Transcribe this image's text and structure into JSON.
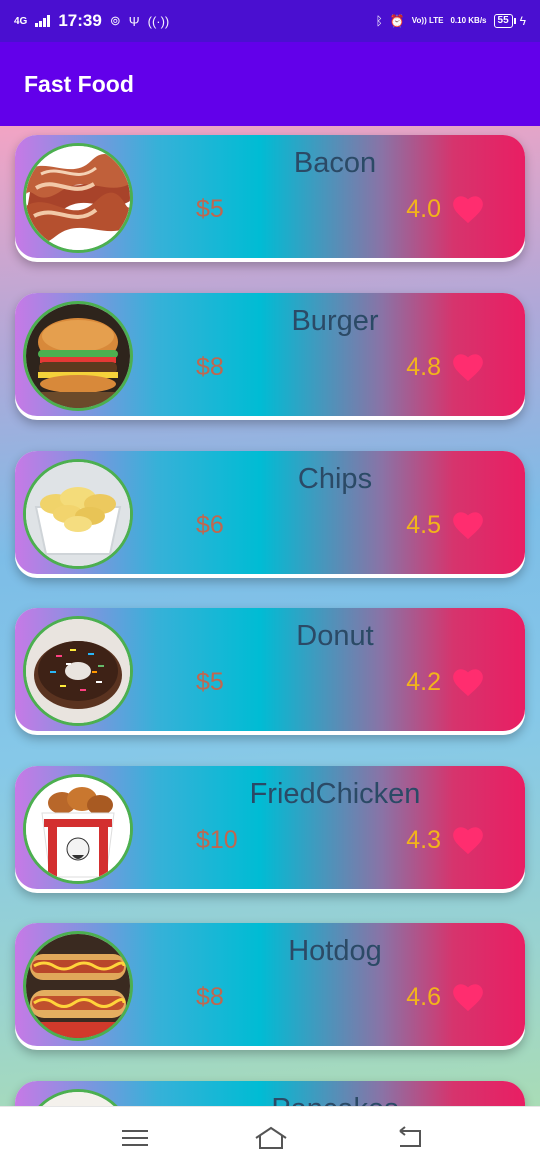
{
  "status_bar": {
    "network": "4G",
    "time": "17:39",
    "volte": "Vo)) LTE",
    "speed": "0.10 KB/s",
    "battery": "55"
  },
  "app_bar": {
    "title": "Fast Food"
  },
  "items": [
    {
      "name": "Bacon",
      "price": "$5",
      "rating": "4.0",
      "image": "bacon-image"
    },
    {
      "name": "Burger",
      "price": "$8",
      "rating": "4.8",
      "image": "burger-image"
    },
    {
      "name": "Chips",
      "price": "$6",
      "rating": "4.5",
      "image": "chips-image"
    },
    {
      "name": "Donut",
      "price": "$5",
      "rating": "4.2",
      "image": "donut-image"
    },
    {
      "name": "FriedChicken",
      "price": "$10",
      "rating": "4.3",
      "image": "fried-chicken-image"
    },
    {
      "name": "Hotdog",
      "price": "$8",
      "rating": "4.6",
      "image": "hotdog-image"
    },
    {
      "name": "Pancakes",
      "price": "",
      "rating": "",
      "image": "pancakes-image"
    }
  ],
  "colors": {
    "status_bar": "#4a0fd0",
    "app_bar": "#6200ea",
    "price": "#c0674f",
    "rating": "#f2b41b",
    "heart": "#ff2d6f",
    "thumb_border": "#4caf50"
  },
  "nav": [
    "menu-icon",
    "home-icon",
    "back-icon"
  ]
}
